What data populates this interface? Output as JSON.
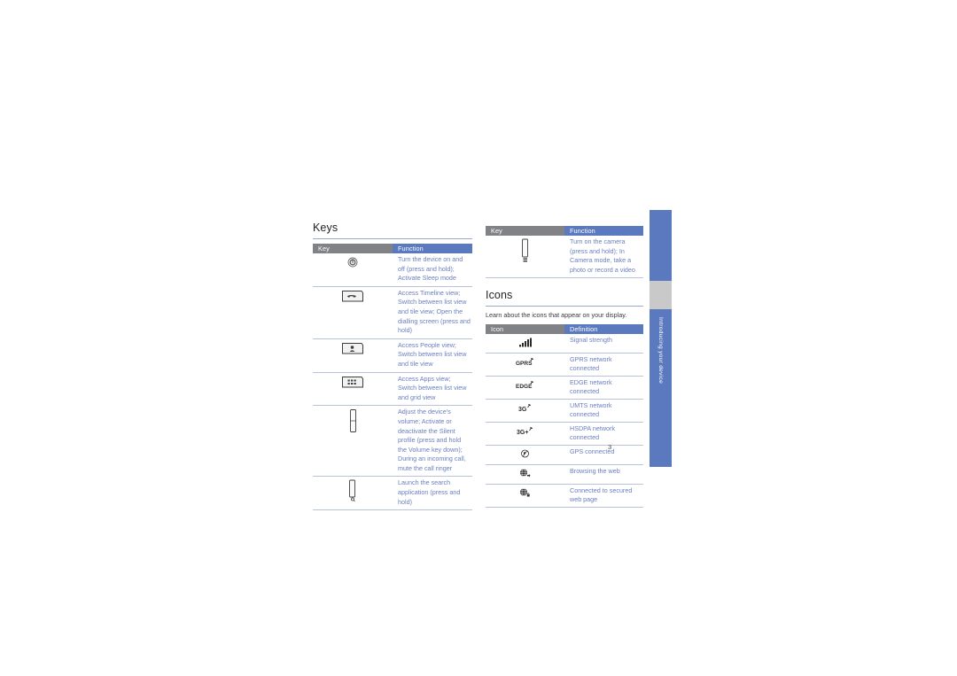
{
  "page": {
    "number": "3",
    "side_tab_label": "Introducing your device",
    "accent_blue": "#5b79bf",
    "text_blue": "#6a7ec0",
    "header_gray": "#808285",
    "rule_color": "#b9c3de"
  },
  "keys_section": {
    "title": "Keys",
    "table": {
      "headers": [
        "Key",
        "Function"
      ],
      "rows": [
        {
          "icon": "power-key-icon",
          "function": "Turn the device on and off (press and hold); Activate Sleep mode"
        },
        {
          "icon": "timeline-key-icon",
          "function": "Access Timeline view; Switch between list view and tile view; Open the dialling screen (press and hold)"
        },
        {
          "icon": "people-key-icon",
          "function": "Access People view; Switch between list view and tile view"
        },
        {
          "icon": "apps-key-icon",
          "function": "Access Apps view; Switch between list view and grid view"
        },
        {
          "icon": "volume-key-icon",
          "function": "Adjust the device's volume; Activate or deactivate the Silent profile (press and hold the Volume key down); During an incoming call, mute the call ringer"
        },
        {
          "icon": "search-key-icon",
          "function": "Launch the search application (press and hold)"
        }
      ]
    }
  },
  "keys_continued": {
    "table": {
      "headers": [
        "Key",
        "Function"
      ],
      "rows": [
        {
          "icon": "camera-key-icon",
          "function": "Turn on the camera (press and hold); In Camera mode, take a photo or record a video"
        }
      ]
    }
  },
  "icons_section": {
    "title": "Icons",
    "intro": "Learn about the icons that appear on your display.",
    "table": {
      "headers": [
        "Icon",
        "Definition"
      ],
      "rows": [
        {
          "icon": "signal-strength-icon",
          "definition": "Signal strength"
        },
        {
          "icon": "gprs-network-icon",
          "definition": "GPRS network connected"
        },
        {
          "icon": "edge-network-icon",
          "definition": "EDGE network connected"
        },
        {
          "icon": "umts-network-icon",
          "definition": "UMTS network connected"
        },
        {
          "icon": "hsdpa-network-icon",
          "definition": "HSDPA network connected"
        },
        {
          "icon": "gps-connected-icon",
          "definition": "GPS connected"
        },
        {
          "icon": "browsing-web-icon",
          "definition": "Browsing the web"
        },
        {
          "icon": "secure-web-icon",
          "definition": "Connected to secured web page"
        }
      ]
    }
  }
}
